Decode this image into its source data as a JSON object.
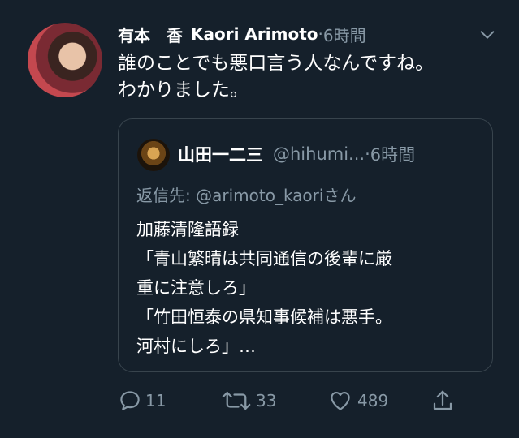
{
  "tweet": {
    "display_name": "有本　香",
    "name_en": "Kaori Arimoto",
    "separator": "·",
    "time": "6時間",
    "text": "誰のことでも悪口言う人なんですね。\nわかりました。",
    "menu_icon": "chevron-down-icon"
  },
  "quote": {
    "display_name": "山田一二三",
    "handle": "@hihumi...",
    "separator": "·",
    "time": "6時間",
    "reply_prefix": "返信先: ",
    "reply_mention": "@arimoto_kaori",
    "reply_suffix": "さん",
    "text": "加藤清隆語録\n「青山繁晴は共同通信の後輩に厳\n重に注意しろ」\n「竹田恒泰の県知事候補は悪手。\n河村にしろ」…"
  },
  "actions": {
    "reply_count": "11",
    "retweet_count": "33",
    "like_count": "489"
  },
  "colors": {
    "background": "#15202b",
    "secondary_text": "#8899a6",
    "border": "#38444d"
  }
}
